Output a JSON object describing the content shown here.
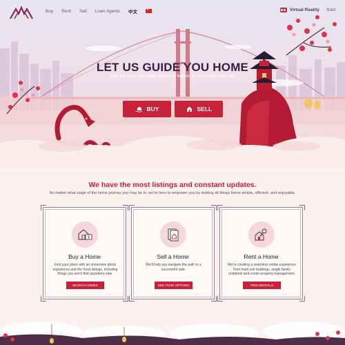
{
  "nav": {
    "links": [
      "Buy",
      "Rent",
      "Sell",
      "Loan Agents",
      "中文"
    ],
    "virtual_reality": "Virtual Reality",
    "sold": "Sold"
  },
  "hero": {
    "title": "LET US GUIDE YOU HOME",
    "subtitle": "With the most complete source of homes & real estate near you",
    "buy_label": "BUY",
    "sell_label": "SELL"
  },
  "content": {
    "title": "We have the most listings and constant updates.",
    "subtitle": "No matter what stage of the home journey you may be in, we're here to empower you by making all things home simple, efficient, and enjoyable."
  },
  "cards": [
    {
      "icon": "house-money-icon",
      "title": "Buy a Home",
      "text": "Find your place with an immersive photo experience and the most listings, including things you won't find anywhere else.",
      "button": "SEARCH HOMES"
    },
    {
      "icon": "house-document-icon",
      "title": "Sell a Home",
      "text": "We'll help you navigate the path to a successful sale.",
      "button": "SEE YOUR OPTIONS"
    },
    {
      "icon": "house-key-icon",
      "title": "Rent a Home",
      "text": "We're creating a seamless online experience from multi unit buildings, single family residents and condo property management.",
      "button": "FIND RENTALS"
    }
  ],
  "colors": {
    "accent": "#c8213a",
    "title_dark": "#3a1e40",
    "card_border": "#9a7e95",
    "icon_bg": "#f7d7db"
  }
}
